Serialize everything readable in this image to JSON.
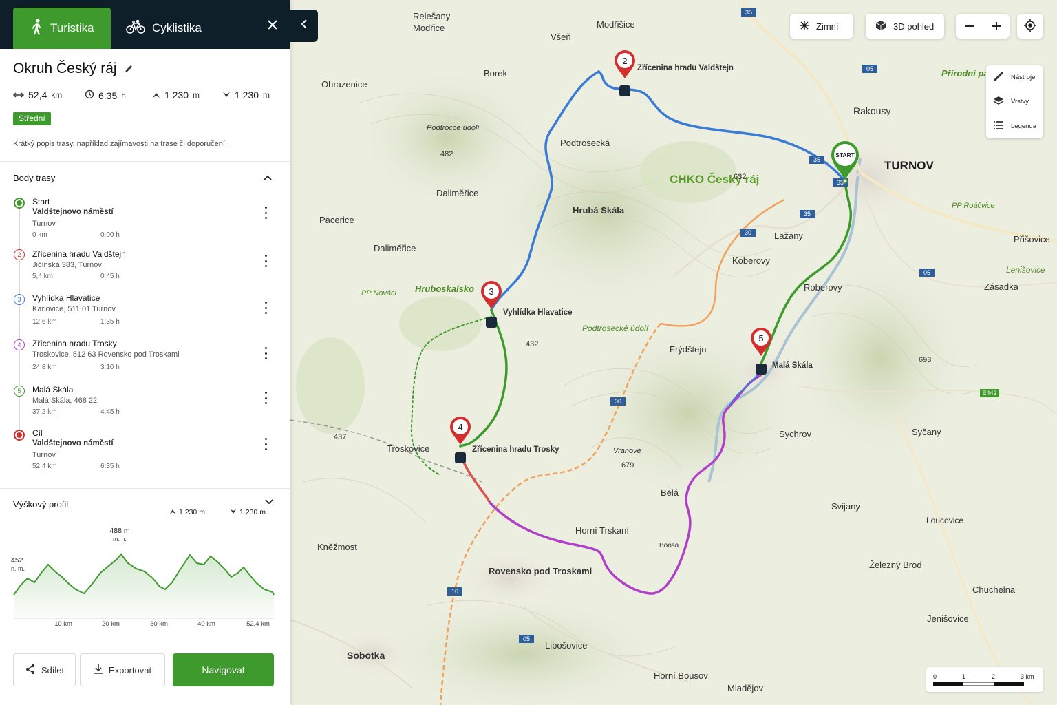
{
  "tabs": {
    "hiking": "Turistika",
    "cycling": "Cyklistika"
  },
  "route": {
    "title": "Okruh Český ráj",
    "distance": "52,4",
    "distance_unit": "km",
    "duration": "6:35",
    "duration_unit": "h",
    "ascent": "1 230",
    "ascent_unit": "m",
    "descent": "1 230",
    "descent_unit": "m",
    "difficulty": "Střední",
    "description": "Krátký popis trasy, například zajímavosti na trase či doporučení."
  },
  "waypoints_section": {
    "title": "Body trasy"
  },
  "waypoints": [
    {
      "label": "Start",
      "name": "Valdštejnovo náměstí",
      "address": "Turnov",
      "km": "0 km",
      "time": "0:00 h",
      "color": "#3e9a2d"
    },
    {
      "label": "2",
      "name": "Zřícenina hradu Valdštejn",
      "address": "Jičínská 383, Turnov",
      "km": "5,4 km",
      "time": "0:45 h",
      "color": "#d32f2f"
    },
    {
      "label": "3",
      "name": "Vyhlídka Hlavatice",
      "address": "Karlovice, 511 01 Turnov",
      "km": "12,6 km",
      "time": "1:35 h",
      "color": "#3a7bd5"
    },
    {
      "label": "4",
      "name": "Zřícenina hradu Trosky",
      "address": "Troskovice, 512 63 Rovensko pod Troskami",
      "km": "24,8 km",
      "time": "3:10 h",
      "color": "#b040c8"
    },
    {
      "label": "5",
      "name": "Malá Skála",
      "address": "Malá Skála, 468 22",
      "km": "37,2 km",
      "time": "4:45 h",
      "color": "#3e9a2d"
    },
    {
      "label": "Cíl",
      "name": "Valdštejnovo náměstí",
      "address": "Turnov",
      "km": "52,4 km",
      "time": "6:35 h",
      "color": "#d32f2f"
    }
  ],
  "profile": {
    "title": "Výškový profil",
    "ascent": "1 230 m",
    "descent": "1 230 m",
    "max_label": "488 m",
    "max_unit": "m. n.",
    "start_label": "452",
    "start_unit": "n. m.",
    "ticks": [
      "10 km",
      "20 km",
      "30 km",
      "40 km",
      "52,4 km"
    ]
  },
  "actions": {
    "share": "Sdílet",
    "export": "Exportovat",
    "navigate": "Navigovat"
  },
  "map_controls": {
    "winter": "Zimní",
    "view3d": "3D pohled",
    "tools": "Nástroje",
    "layers": "Vrstvy",
    "legend": "Legenda"
  },
  "scale": [
    "0",
    "1",
    "2",
    "3 km"
  ],
  "map_labels": {
    "towns": [
      "Relešany",
      "Modřice",
      "Modřišice",
      "Všeň",
      "Borek",
      "Ohrazenice",
      "Rakousy",
      "TURNOV",
      "Podtrosecká",
      "Daliměřice",
      "Pacerice",
      "Daliměřice",
      "Hrubá Skála",
      "Lažany",
      "Koberovy",
      "Přišovice",
      "Zásadka",
      "Lenišovice",
      "Roberovy",
      "Frýdštejn",
      "Sychrov",
      "Syčany",
      "Troskovice",
      "Vranové",
      "Bělá",
      "Svijany",
      "Horní Trskaní",
      "Kněžmost",
      "Rovensko pod Troskami",
      "Železný Brod",
      "Chuchelna",
      "Loučovice",
      "Jenišovice",
      "Libošovice",
      "Sobotka",
      "Horní Bousov",
      "Mladějov",
      "Boosa"
    ],
    "area": "CHKO Český ráj",
    "area_hruboskalsko": "Hruboskalsko",
    "area_podtrosecke": "Podtrosecké údolí",
    "area_prirodni": "Přírodní park",
    "pp_rocovice": "PP Roáčvice",
    "pp_novaci": "PP Nováci",
    "podtrocce_udoli": "Podtrocce údolí",
    "poi_valdstejn": "Zřícenina hradu Valdštejn",
    "poi_hlavatice": "Vyhlídka Hlavatice",
    "poi_trosky": "Zřícenina hradu Trosky",
    "poi_mala_skala": "Malá Skála",
    "start_pin": "START",
    "elev": [
      "482",
      "632",
      "432",
      "679",
      "437",
      "693"
    ],
    "roads": [
      "35",
      "35",
      "35",
      "05",
      "05",
      "30",
      "30",
      "35",
      "10",
      "05",
      "E442"
    ]
  }
}
